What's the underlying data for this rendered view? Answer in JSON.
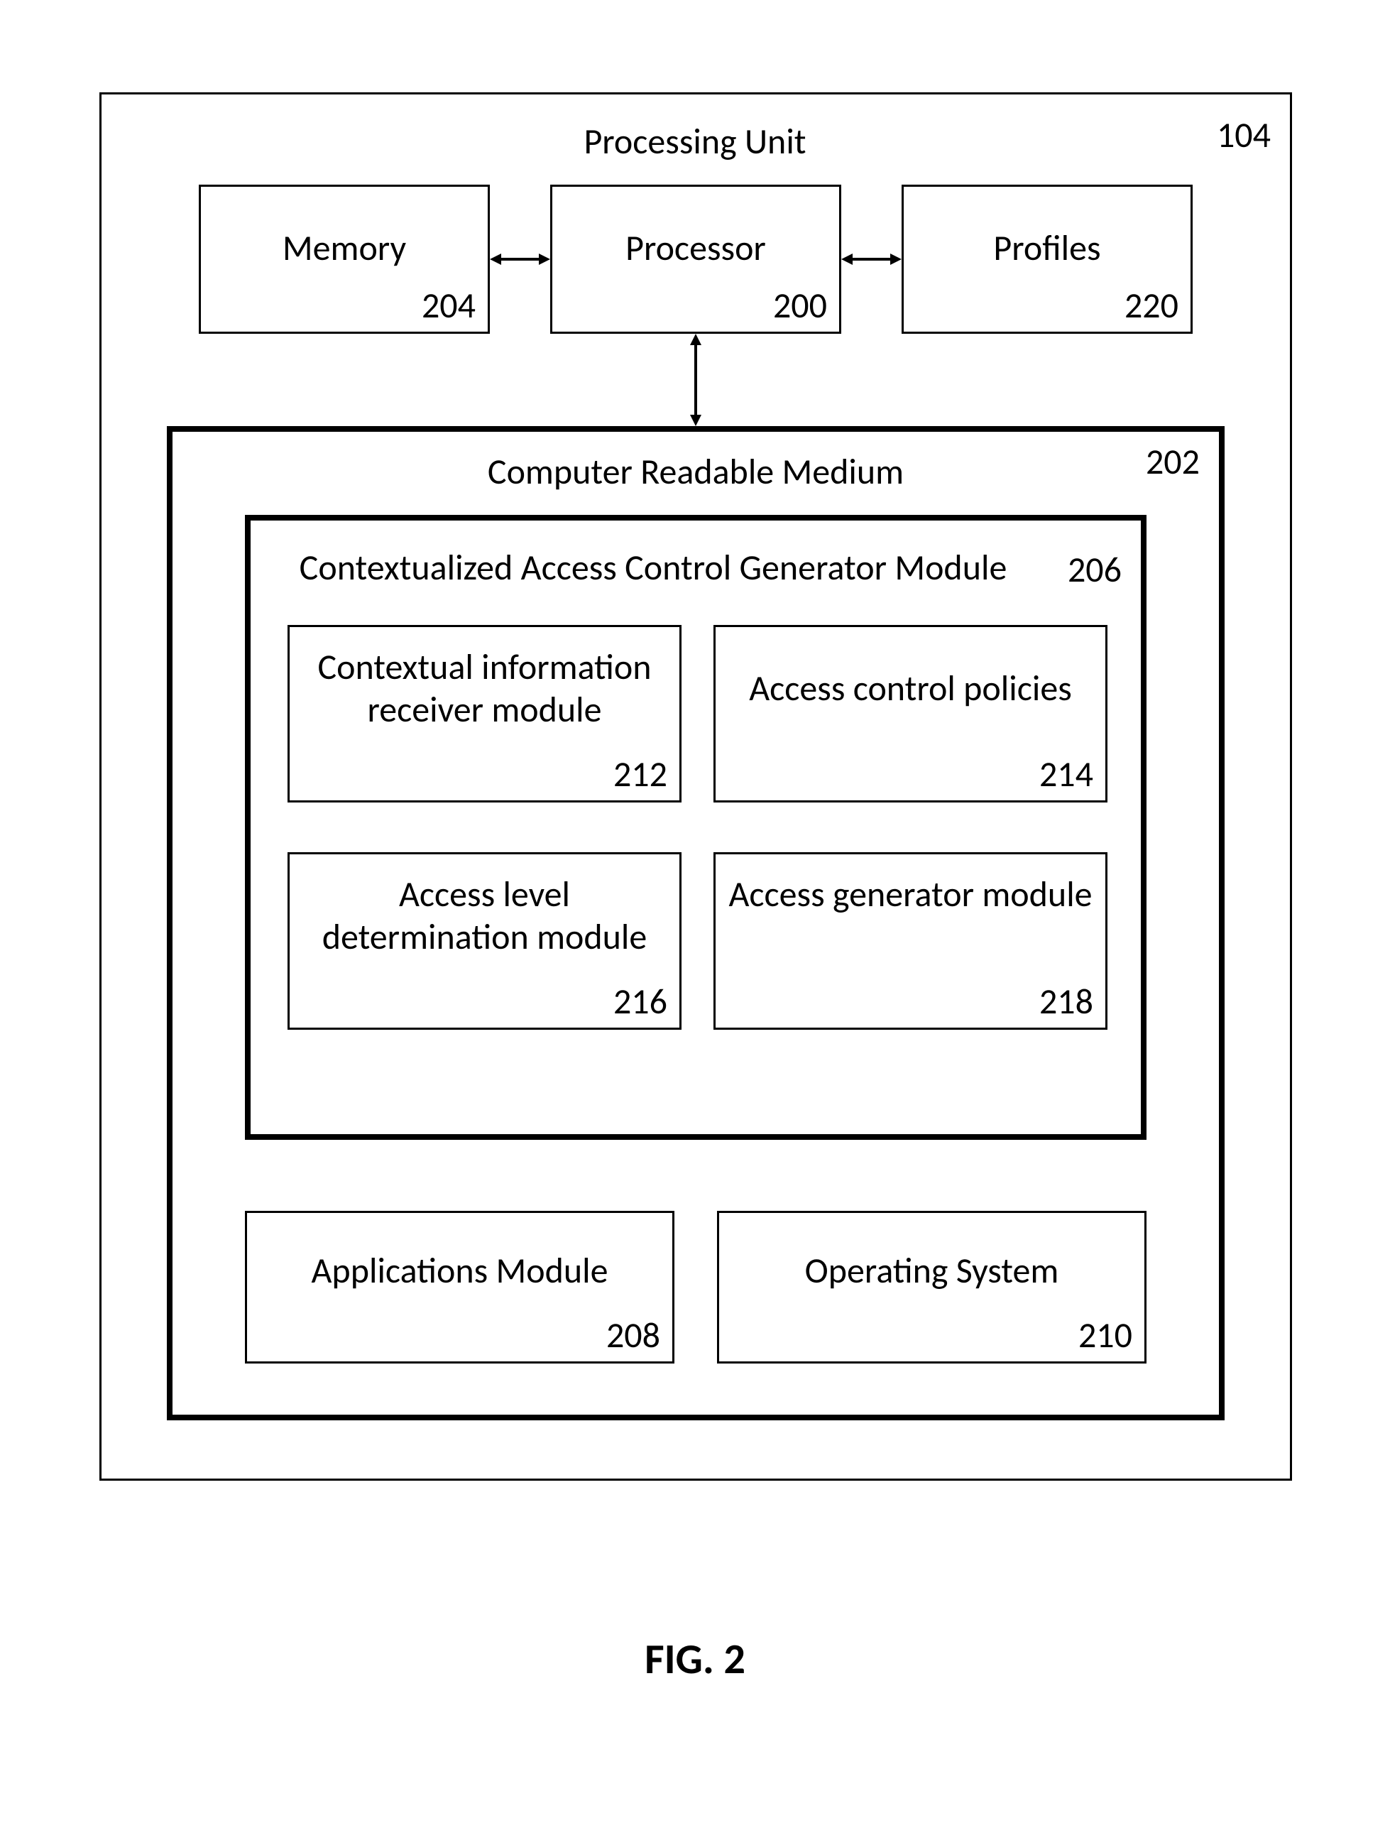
{
  "figure_caption": "FIG. 2",
  "outer": {
    "title": "Processing Unit",
    "ref": "104"
  },
  "top_row": {
    "memory": {
      "label": "Memory",
      "ref": "204"
    },
    "processor": {
      "label": "Processor",
      "ref": "200"
    },
    "profiles": {
      "label": "Profiles",
      "ref": "220"
    }
  },
  "crm": {
    "title": "Computer Readable Medium",
    "ref": "202",
    "module": {
      "title": "Contextualized Access Control Generator Module",
      "ref": "206",
      "children": {
        "ctx_recv": {
          "label": "Contextual information receiver module",
          "ref": "212"
        },
        "policies": {
          "label": "Access control policies",
          "ref": "214"
        },
        "level": {
          "label": "Access level determination module",
          "ref": "216"
        },
        "gen": {
          "label": "Access generator module",
          "ref": "218"
        }
      }
    },
    "apps": {
      "label": "Applications Module",
      "ref": "208"
    },
    "os": {
      "label": "Operating System",
      "ref": "210"
    }
  }
}
